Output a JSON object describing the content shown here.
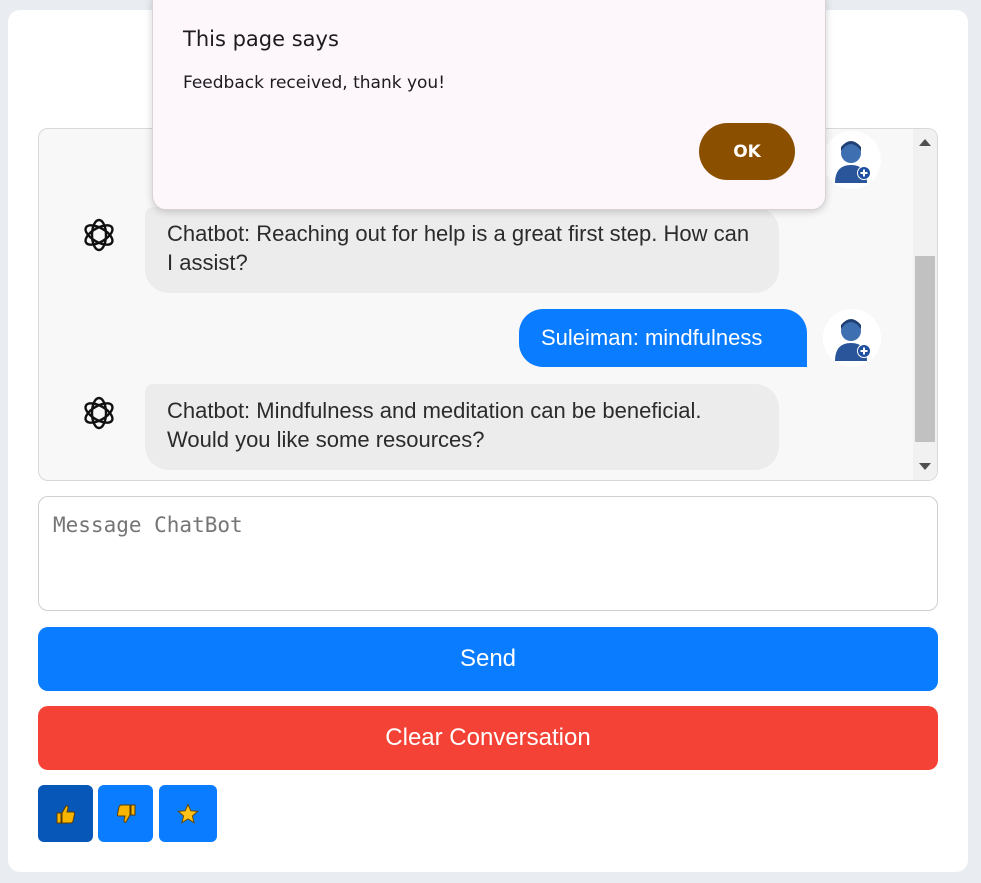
{
  "dialog": {
    "title": "This page says",
    "message": "Feedback received, thank you!",
    "ok_label": "OK"
  },
  "chat": {
    "messages": [
      {
        "sender": "bot",
        "text": "Chatbot: Reaching out for help is a great first step. How can I assist?"
      },
      {
        "sender": "user",
        "text": "Suleiman: mindfulness"
      },
      {
        "sender": "bot",
        "text": "Chatbot: Mindfulness and meditation can be beneficial. Would you like some resources?"
      }
    ]
  },
  "input": {
    "placeholder": "Message ChatBot"
  },
  "buttons": {
    "send": "Send",
    "clear": "Clear Conversation"
  },
  "feedback": {
    "items": [
      {
        "icon": "thumbs-up-icon",
        "active": true
      },
      {
        "icon": "thumbs-down-icon",
        "active": false
      },
      {
        "icon": "star-icon",
        "active": false
      }
    ]
  },
  "colors": {
    "primary": "#0a7cff",
    "danger": "#f44336",
    "dialog_button": "#8b4f00",
    "bot_bubble": "#ececec"
  }
}
